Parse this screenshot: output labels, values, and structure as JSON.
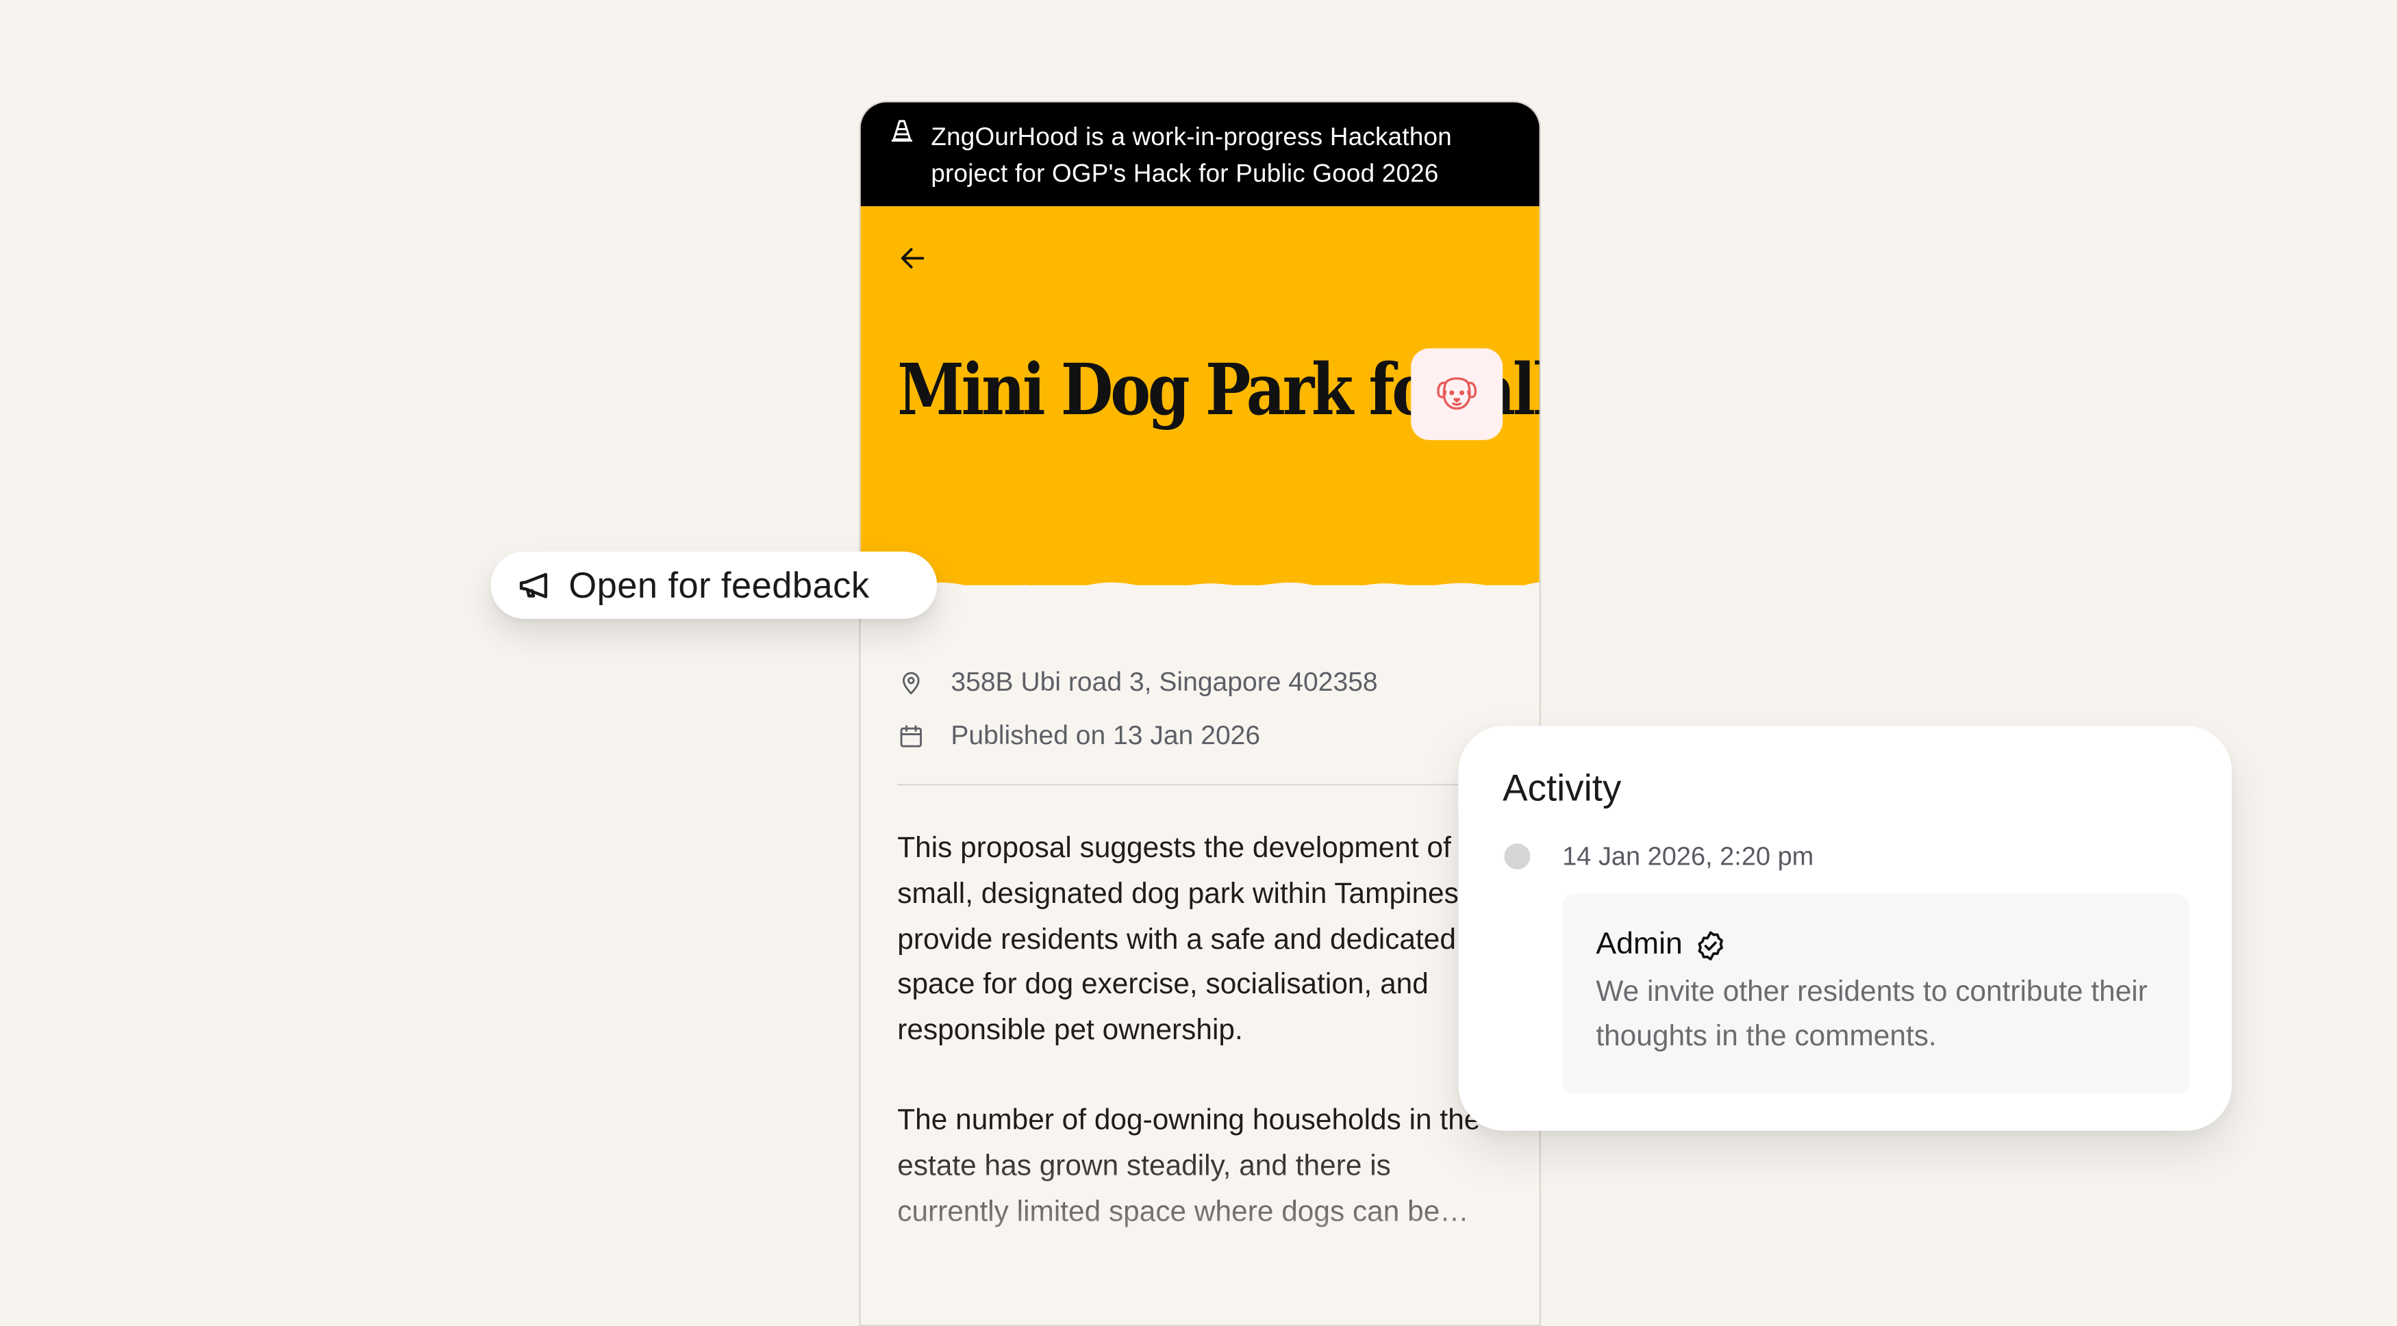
{
  "banner": {
    "text": "ZngOurHood is a work-in-progress Hackathon project for OGP's Hack for Public Good 2026"
  },
  "proposal": {
    "title": "Mini Dog Park for all Pet Owners",
    "address": "358B Ubi road 3, Singapore 402358",
    "published": "Published on 13 Jan 2026",
    "paragraphs": [
      "This proposal suggests the development of a small, designated dog park within Tampines to provide residents with a safe and dedicated space for dog exercise, socialisation, and responsible pet ownership.",
      "The number of dog-owning households in the estate has grown steadily, and there is currently limited space where dogs can be…"
    ]
  },
  "status_pill": {
    "label": "Open for feedback"
  },
  "activity": {
    "title": "Activity",
    "timestamp": "14 Jan 2026, 2:20 pm",
    "author": "Admin",
    "message": "We invite other residents to contribute their thoughts in the comments."
  },
  "colors": {
    "hero": "#ffb800",
    "banner": "#000000",
    "background": "#f7f4ef",
    "dog_icon": "#e85a5a"
  },
  "icons": [
    "traffic-cone-icon",
    "back-arrow-icon",
    "dog-icon",
    "location-pin-icon",
    "calendar-icon",
    "megaphone-icon",
    "verified-badge-icon"
  ]
}
